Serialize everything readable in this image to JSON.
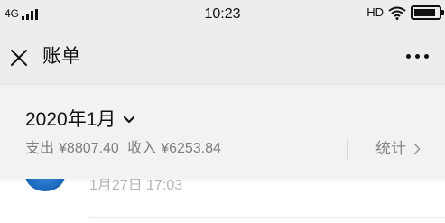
{
  "status_bar": {
    "network": "4G",
    "time": "10:23",
    "hd": "HD",
    "battery_level": 0.9,
    "icons": [
      "signal-icon",
      "wifi-icon",
      "battery-icon"
    ]
  },
  "nav": {
    "title": "账单",
    "close_icon": "close-icon",
    "more_icon": "more-icon"
  },
  "summary": {
    "month": "2020年1月",
    "expense_label": "支出",
    "expense_amount": "¥8807.40",
    "income_label": "收入",
    "income_amount": "¥6253.84",
    "stats_label": "统计"
  },
  "bills": [
    {
      "time": "1月27日 17:03"
    }
  ],
  "colors": {
    "bar_background": "#ededed",
    "summary_background": "#f2f2f2",
    "secondary_text": "#7f7f7f",
    "avatar_blue": "#1f6fc4"
  }
}
